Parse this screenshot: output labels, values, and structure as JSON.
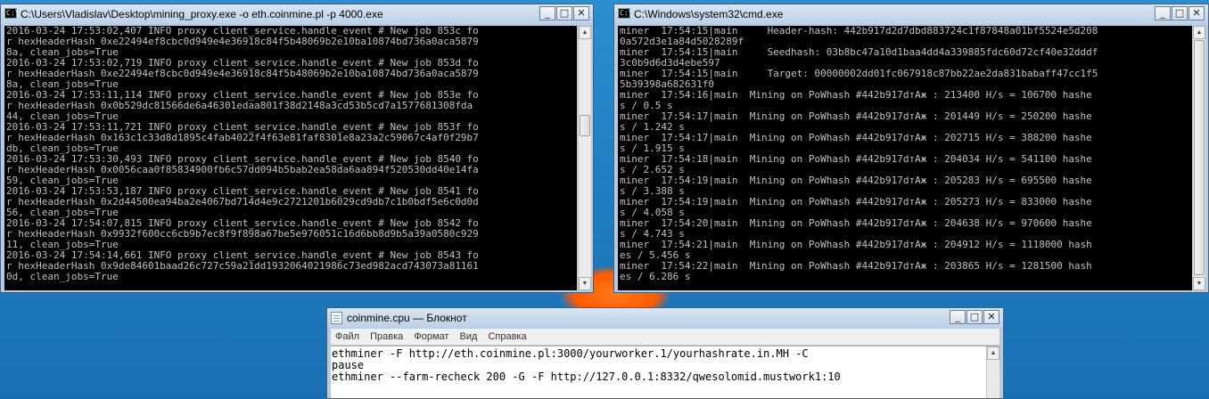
{
  "window_left": {
    "title": "C:\\Users\\Vladislav\\Desktop\\mining_proxy.exe -o eth.coinmine.pl -p 4000.exe",
    "lines": [
      "2016-03-24 17:53:02,407 INFO proxy client_service.handle_event # New job 853c fo",
      "r hexHeaderHash 0xe22494ef8cbc0d949e4e36918c84f5b48069b2e10ba10874bd736a0aca5879",
      "8a, clean_jobs=True",
      "2016-03-24 17:53:02,719 INFO proxy client_service.handle_event # New job 853d fo",
      "r hexHeaderHash 0xe22494ef8cbc0d949e4e36918c84f5b48069b2e10ba10874bd736a0aca5879",
      "8a, clean_jobs=True",
      "2016-03-24 17:53:11,114 INFO proxy client_service.handle_event # New job 853e fo",
      "r hexHeaderHash 0x0b529dc81566de6a46301edaa801f38d2148a3cd53b5cd7a1577681308fda",
      "44, clean_jobs=True",
      "2016-03-24 17:53:11,721 INFO proxy client_service.handle_event # New job 853f fo",
      "r hexHeaderHash 0x163c1c33d8d1895c4fab4022f4f63e81faf8301e8a23a2c59067c4af0f29b7",
      "db, clean_jobs=True",
      "2016-03-24 17:53:30,493 INFO proxy client_service.handle_event # New job 8540 fo",
      "r hexHeaderHash 0x0056caa0f85834900fb6c57dd094b5bab2ea58da6aa894f520530dd40e14fa",
      "59, clean_jobs=True",
      "2016-03-24 17:53:53,187 INFO proxy client_service.handle_event # New job 8541 fo",
      "r hexHeaderHash 0x2d44500ea94ba2e4067bd714d4e9c2721201b6029cd9db7c1b0bdf5e6c0d0d",
      "56, clean_jobs=True",
      "2016-03-24 17:54:07,815 INFO proxy client_service.handle_event # New job 8542 fo",
      "r hexHeaderHash 0x9932f600cc6cb9b7ec8f9f898a67be5e976051c16d6bb8d9b5a39a0580c929",
      "11, clean_jobs=True",
      "2016-03-24 17:54:14,661 INFO proxy client_service.handle_event # New job 8543 fo",
      "r hexHeaderHash 0x9de84601baad26c727c59a21dd1932064021986c73ed982acd743073a81161",
      "0d, clean_jobs=True"
    ]
  },
  "window_right": {
    "title": "C:\\Windows\\system32\\cmd.exe",
    "lines": [
      "miner  17:54:15|main     Header-hash: 442b917d2d7dbd883724c1f87848a01bf5524e5d208",
      "0a572d3e1a84d5028289f",
      "miner  17:54:15|main     Seedhash: 03b8bc47a10d1baa4dd4a339885fdc60d72cf40e32dddf",
      "3c0b9d6d3d4ebe597",
      "miner  17:54:15|main     Target: 00000002dd01fc067918c87bb22ae2da831babaff47cc1f5",
      "5b39398a682631f0",
      "miner  17:54:16|main  Mining on PoWhash #442b917dтАж : 213400 H/s = 106700 hashe",
      "s / 0.5 s",
      "miner  17:54:17|main  Mining on PoWhash #442b917dтАж : 201449 H/s = 250200 hashe",
      "s / 1.242 s",
      "miner  17:54:17|main  Mining on PoWhash #442b917dтАж : 202715 H/s = 388200 hashe",
      "s / 1.915 s",
      "miner  17:54:18|main  Mining on PoWhash #442b917dтАж : 204034 H/s = 541100 hashe",
      "s / 2.652 s",
      "miner  17:54:19|main  Mining on PoWhash #442b917dтАж : 205283 H/s = 695500 hashe",
      "s / 3.388 s",
      "miner  17:54:19|main  Mining on PoWhash #442b917dтАж : 205273 H/s = 833000 hashe",
      "s / 4.058 s",
      "miner  17:54:20|main  Mining on PoWhash #442b917dтАж : 204638 H/s = 970600 hashe",
      "s / 4.743 s",
      "miner  17:54:21|main  Mining on PoWhash #442b917dтАж : 204912 H/s = 1118000 hash",
      "es / 5.456 s",
      "miner  17:54:22|main  Mining on PoWhash #442b917dтАж : 203865 H/s = 1281500 hash",
      "es / 6.286 s"
    ]
  },
  "notepad": {
    "title": "coinmine.cpu — Блокнот",
    "menu": [
      "Файл",
      "Правка",
      "Формат",
      "Вид",
      "Справка"
    ],
    "lines": [
      "ethminer -F http://eth.coinmine.pl:3000/yourworker.1/yourhashrate.in.MH -C",
      "pause",
      "ethminer --farm-recheck 200 -G -F http://127.0.0.1:8332/qwesolomid.mustwork1:10"
    ]
  },
  "controls": {
    "minimize": "_",
    "maximize": "□",
    "close": "✕",
    "scroll_up": "▲",
    "scroll_down": "▼",
    "cmd_glyph": "C:\\"
  },
  "colors": {
    "console_bg": "#000000",
    "console_text": "#c0c0c0",
    "desktop": "#1f7fc4",
    "accent_glow": "#ff6a00"
  }
}
